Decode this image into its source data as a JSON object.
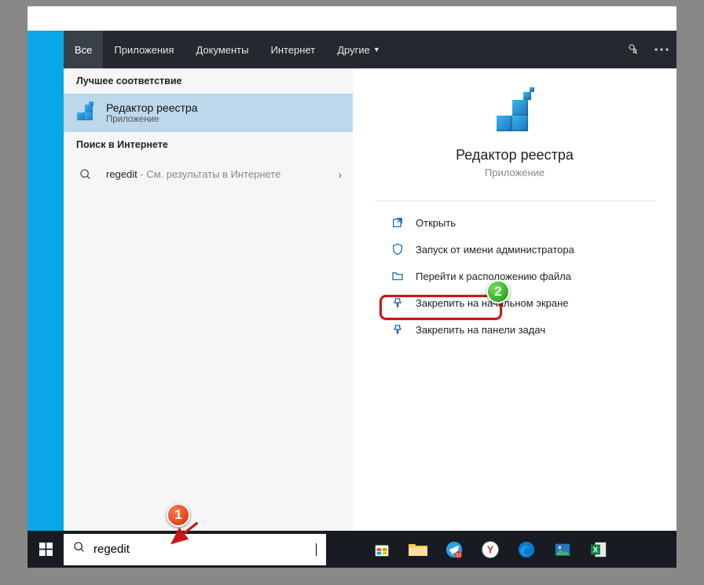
{
  "topbar": {
    "tabs": [
      "Все",
      "Приложения",
      "Документы",
      "Интернет",
      "Другие"
    ],
    "active_index": 0
  },
  "left": {
    "best_match_header": "Лучшее соответствие",
    "best_match": {
      "title": "Редактор реестра",
      "subtitle": "Приложение"
    },
    "web_header": "Поиск в Интернете",
    "web_query": "regedit",
    "web_suffix": " - См. результаты в Интернете"
  },
  "detail": {
    "title": "Редактор реестра",
    "subtitle": "Приложение",
    "actions": [
      {
        "icon": "open-icon",
        "label": "Открыть"
      },
      {
        "icon": "shield-icon",
        "label": "Запуск от имени администратора"
      },
      {
        "icon": "folder-icon",
        "label": "Перейти к расположению файла"
      },
      {
        "icon": "pin-icon",
        "label": "Закрепить на начальном экране"
      },
      {
        "icon": "pin-icon",
        "label": "Закрепить на панели задач"
      }
    ]
  },
  "search": {
    "value": "regedit"
  },
  "badges": {
    "one": "1",
    "two": "2"
  },
  "taskbar_apps": [
    "store",
    "explorer",
    "telegram",
    "yandex",
    "edge",
    "photos",
    "excel"
  ]
}
